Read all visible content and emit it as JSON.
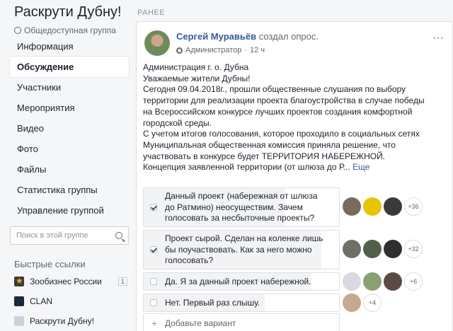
{
  "group": {
    "title": "Раскрути Дубну!",
    "type_label": "Общедоступная группа"
  },
  "nav": {
    "items": [
      {
        "label": "Информация",
        "active": false
      },
      {
        "label": "Обсуждение",
        "active": true
      },
      {
        "label": "Участники",
        "active": false
      },
      {
        "label": "Мероприятия",
        "active": false
      },
      {
        "label": "Видео",
        "active": false
      },
      {
        "label": "Фото",
        "active": false
      },
      {
        "label": "Файлы",
        "active": false
      },
      {
        "label": "Статистика группы",
        "active": false
      },
      {
        "label": "Управление группой",
        "active": false
      }
    ]
  },
  "search": {
    "placeholder": "Поиск в этой группе"
  },
  "quick_links": {
    "title": "Быстрые ссылки",
    "items": [
      {
        "label": "Зообизнес России",
        "badge": "1",
        "icon_color": "#3b3b3b"
      },
      {
        "label": "CLAN",
        "badge": "",
        "icon_color": "#1b2a3a"
      },
      {
        "label": "Раскрути Дубну!",
        "badge": "",
        "icon_color": "#c9d2da"
      }
    ]
  },
  "feed": {
    "section_label": "РАНЕЕ"
  },
  "post": {
    "author": "Сергей Муравьёв",
    "action": "создал опрос.",
    "role": "Администратор",
    "time": "12 ч",
    "lines": [
      "Администрация г. о. Дубна",
      "Уважаемые жители Дубны!",
      "Сегодня 09.04.2018г., прошли общественные слушания по выбору",
      "территории для реализации проекта благоустройства в случае победы",
      "на Всероссийском конкурсе лучших проектов создания комфортной",
      "городской среды.",
      "С учетом итогов голосования, которое проходило в социальных сетях",
      "Муниципальная общественная комиссия приняла решение, что",
      "участвовать в конкурсе будет ТЕРРИТОРИЯ НАБЕРЕЖНОЙ.",
      "Концепция заявленной территории (от шлюза до Р..."
    ],
    "more_label": "Еще"
  },
  "poll": {
    "options": [
      {
        "lines": [
          "Данный проект (набережная от шлюза",
          "до Ратмино) неосуществим. Зачем",
          "голосовать за несбыточные проекты?"
        ],
        "checked": true,
        "fill": 0.72,
        "more_voters": "+36"
      },
      {
        "lines": [
          "Проект сырой. Сделан на коленке лишь",
          "бы поучаствовать. Как за него можно",
          "голосовать?"
        ],
        "checked": true,
        "fill": 0.91,
        "more_voters": "+32"
      },
      {
        "lines": [
          "Да. Я за данный проект набережной."
        ],
        "checked": false,
        "fill": 0.86,
        "more_voters": "+6"
      },
      {
        "lines": [
          "Нет. Первый раз слышу."
        ],
        "checked": false,
        "fill": 0.62,
        "more_voters": "+4"
      }
    ],
    "add_placeholder": "Добавьте вариант"
  }
}
